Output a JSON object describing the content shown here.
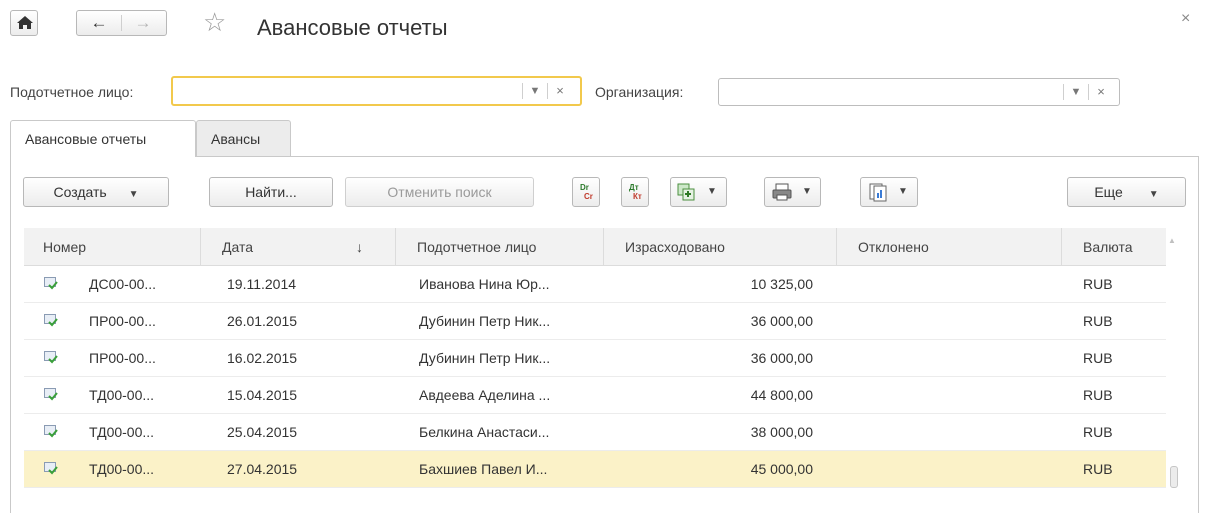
{
  "window": {
    "title": "Авансовые отчеты"
  },
  "filters": {
    "person_label": "Подотчетное лицо:",
    "person_value": "",
    "org_label": "Организация:",
    "org_value": ""
  },
  "tabs": [
    {
      "label": "Авансовые отчеты",
      "active": true
    },
    {
      "label": "Авансы",
      "active": false
    }
  ],
  "toolbar": {
    "create_label": "Создать",
    "find_label": "Найти...",
    "cancel_search_label": "Отменить поиск",
    "more_label": "Еще",
    "dr_top": "Dr",
    "dr_bottom": "Cr",
    "dt_top": "Дт",
    "dt_bottom": "Кт"
  },
  "table": {
    "columns": [
      "Номер",
      "Дата",
      "Подотчетное лицо",
      "Израсходовано",
      "Отклонено",
      "Валюта"
    ],
    "sort_indicator": "↓",
    "rows": [
      {
        "number": "ДС00-00...",
        "date": "19.11.2014",
        "person": "Иванова Нина Юр...",
        "spent": "10 325,00",
        "rejected": "",
        "currency": "RUB"
      },
      {
        "number": "ПР00-00...",
        "date": "26.01.2015",
        "person": "Дубинин Петр Ник...",
        "spent": "36 000,00",
        "rejected": "",
        "currency": "RUB"
      },
      {
        "number": "ПР00-00...",
        "date": "16.02.2015",
        "person": "Дубинин Петр Ник...",
        "spent": "36 000,00",
        "rejected": "",
        "currency": "RUB"
      },
      {
        "number": "ТД00-00...",
        "date": "15.04.2015",
        "person": "Авдеева Аделина ...",
        "spent": "44 800,00",
        "rejected": "",
        "currency": "RUB"
      },
      {
        "number": "ТД00-00...",
        "date": "25.04.2015",
        "person": "Белкина Анастаси...",
        "spent": "38 000,00",
        "rejected": "",
        "currency": "RUB"
      },
      {
        "number": "ТД00-00...",
        "date": "27.04.2015",
        "person": "Бахшиев Павел И...",
        "spent": "45 000,00",
        "rejected": "",
        "currency": "RUB",
        "selected": true
      }
    ]
  },
  "icons": {
    "home": "home-icon",
    "back": "arrow-left-icon",
    "forward": "arrow-right-icon",
    "favorite": "star-icon",
    "close": "close-icon",
    "doc_posted": "document-posted-icon"
  },
  "colors": {
    "focus_border": "#f2c94c",
    "selected_row": "#fbf2c8",
    "header_bg": "#f2f2f2"
  }
}
